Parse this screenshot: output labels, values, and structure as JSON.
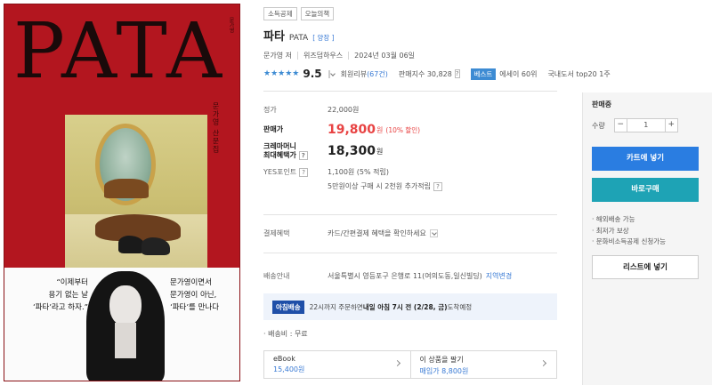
{
  "cover": {
    "title": "PATA",
    "author_vertical": "문가영 산문집",
    "top_vertical": "문가영",
    "quote_left": "“이제부터\n용기 없는 날\n‘파타’라고 하자.”",
    "quote_right": "문가영이면서\n문가영이 아닌,\n‘파타’를 만나다"
  },
  "tags": [
    "소득공제",
    "오늘의책"
  ],
  "book": {
    "title": "파타",
    "subtitle": "PATA",
    "binding": "[ 양장 ]",
    "author": "문가영 저",
    "publisher": "위즈덤하우스",
    "date": "2024년 03월 06일"
  },
  "rating": {
    "stars": "★★★★★",
    "score": "9.5",
    "reviews_label": "회원리뷰",
    "reviews_count": "(67건)",
    "sales_index": "판매지수 30,828",
    "best_badge": "베스트",
    "best_rank1": "에세이 60위",
    "best_rank2": "국내도서 top20 1주"
  },
  "price": {
    "list_label": "정가",
    "list_value": "22,000원",
    "sale_label": "판매가",
    "sale_value": "19,800",
    "sale_unit": "원",
    "discount": "(10% 할인)",
    "crema_label1": "크레마머니",
    "crema_label2": "최대혜택가",
    "crema_value": "18,300",
    "crema_unit": "원",
    "points_label": "YES포인트",
    "points_value": "1,100원 (5% 적립)",
    "points_extra": "5만원이상 구매 시 2천원 추가적립"
  },
  "payment": {
    "label": "결제혜택",
    "text": "카드/간편결제 혜택을 확인하세요"
  },
  "shipping": {
    "label": "배송안내",
    "address": "서울특별시 영등포구 은행로 11(여의도동,일신빌딩)",
    "change": "지역변경",
    "morning_badge": "아침배송",
    "morning_pre": "22시까지 주문하면 ",
    "morning_bold": "내일 아침 7시 전 (2/28, 금)",
    "morning_post": " 도착예정",
    "fee": "· 배송비 : 무료"
  },
  "formats": [
    {
      "name": "eBook",
      "price": "15,400원"
    },
    {
      "name": "이 상품을 팔기",
      "price": "매입가 8,800원"
    }
  ],
  "panel": {
    "status": "판매중",
    "qty_label": "수량",
    "qty_minus": "−",
    "qty_value": "1",
    "qty_plus": "+",
    "cart": "카트에 넣기",
    "buy": "바로구매",
    "benefits": [
      "· 해외배송 가능",
      "· 최저가 보상",
      "· 문화비소득공제 신청가능"
    ],
    "wishlist": "리스트에 넣기"
  },
  "colors": {
    "cover_red": "#b3161f",
    "sale_red": "#e84343",
    "cart_blue": "#2a7de1",
    "buy_teal": "#1ea3b5",
    "accent_blue": "#3a7bd5"
  }
}
